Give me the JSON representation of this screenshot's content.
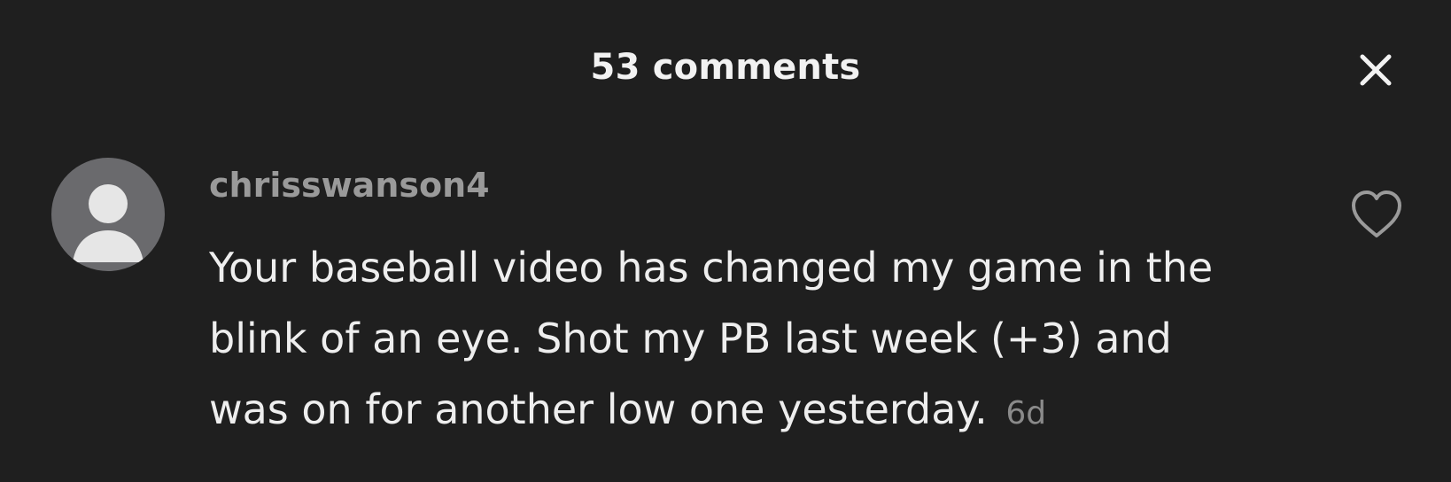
{
  "header": {
    "title": "53 comments",
    "close_icon": "close-icon"
  },
  "comment": {
    "avatar_icon": "default-avatar-icon",
    "username": "chrisswanson4",
    "text": "Your baseball video has changed my game in the blink of an eye. Shot my PB last week (+3) and was on for another low one yesterday.",
    "timestamp": "6d",
    "like_icon": "heart-outline-icon"
  },
  "colors": {
    "background": "#1f1f1f",
    "title_text": "#f2f2f2",
    "username_text": "#9a9a9a",
    "comment_text": "#eeeeee",
    "timestamp_text": "#8a8a8a",
    "avatar_bg": "#6a6a6d"
  }
}
